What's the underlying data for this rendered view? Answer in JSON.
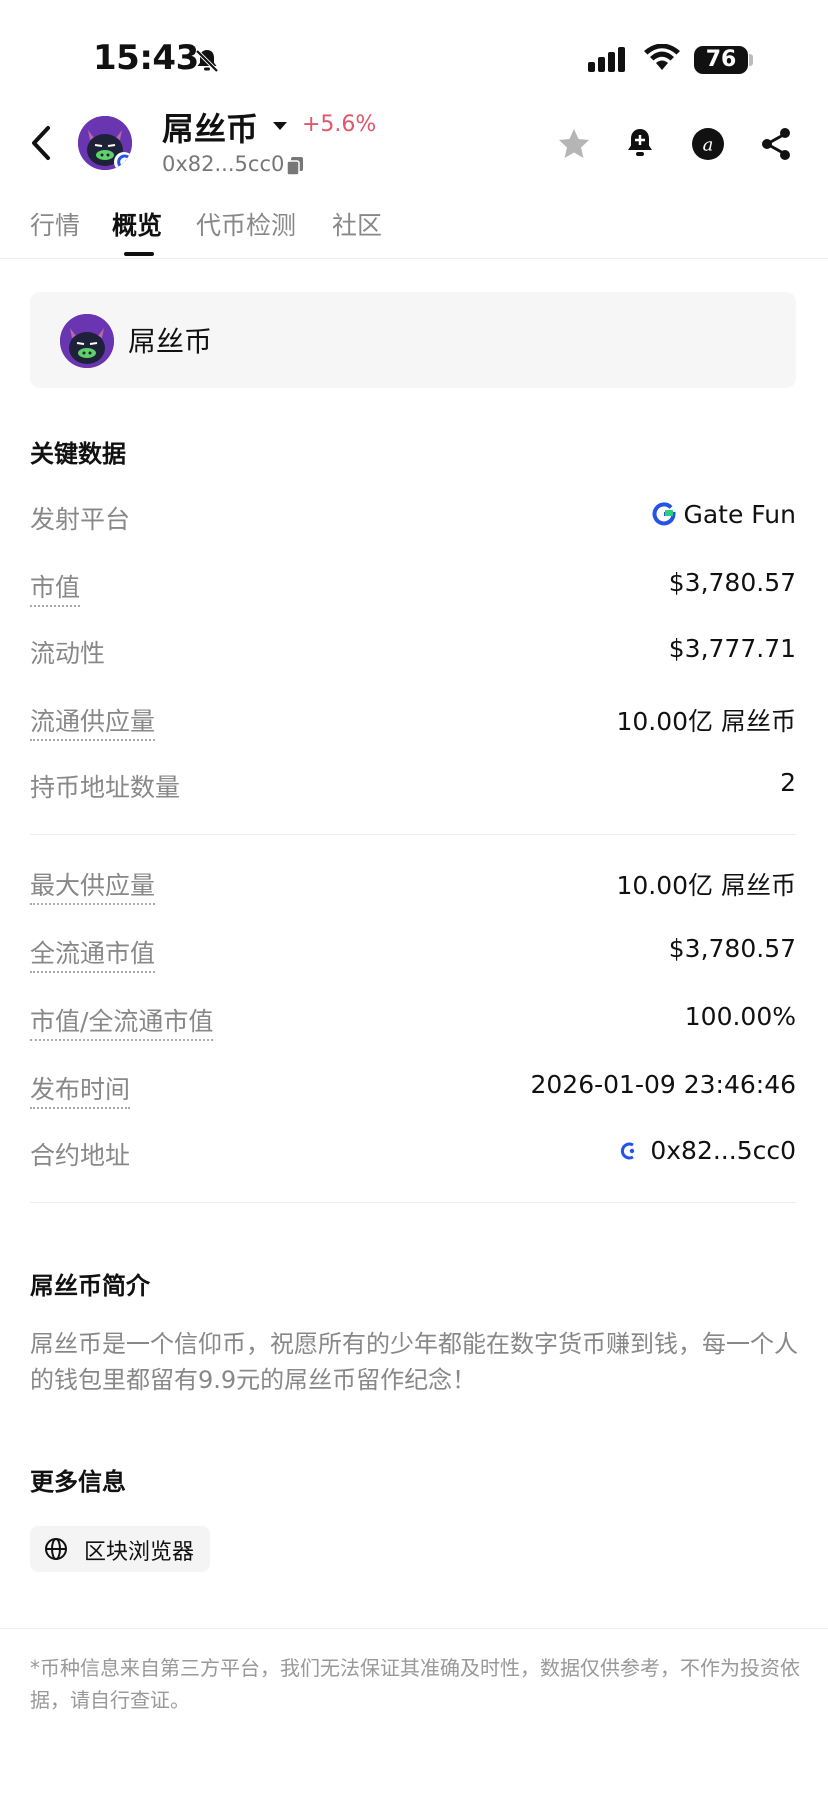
{
  "status_bar": {
    "time": "15:43",
    "battery": "76"
  },
  "header": {
    "token_name": "屌丝币",
    "change": "+5.6%",
    "address": "0x82...5cc0"
  },
  "tabs": [
    {
      "label": "行情"
    },
    {
      "label": "概览"
    },
    {
      "label": "代币检测"
    },
    {
      "label": "社区"
    }
  ],
  "token_card": {
    "name": "屌丝币"
  },
  "key_data": {
    "title": "关键数据",
    "rows": [
      {
        "label": "发射平台",
        "value": "Gate Fun"
      },
      {
        "label": "市值",
        "value": "$3,780.57"
      },
      {
        "label": "流动性",
        "value": "$3,777.71"
      },
      {
        "label": "流通供应量",
        "value": "10.00亿 屌丝币"
      },
      {
        "label": "持币地址数量",
        "value": "2"
      },
      {
        "label": "最大供应量",
        "value": "10.00亿 屌丝币"
      },
      {
        "label": "全流通市值",
        "value": "$3,780.57"
      },
      {
        "label": "市值/全流通市值",
        "value": "100.00%"
      },
      {
        "label": "发布时间",
        "value": "2026-01-09 23:46:46"
      },
      {
        "label": "合约地址",
        "value": "0x82...5cc0"
      }
    ]
  },
  "intro": {
    "title": "屌丝币简介",
    "text": "屌丝币是一个信仰币，祝愿所有的少年都能在数字货币赚到钱，每一个人的钱包里都留有9.9元的屌丝币留作纪念！"
  },
  "more_info": {
    "title": "更多信息",
    "explorer_label": "区块浏览器"
  },
  "disclaimer": "*币种信息来自第三方平台，我们无法保证其准确及时性，数据仅供参考，不作为投资依据，请自行查证。",
  "colors": {
    "positive": "#e0566b",
    "gate_blue": "#2354e6",
    "gate_green": "#2bd07a"
  }
}
